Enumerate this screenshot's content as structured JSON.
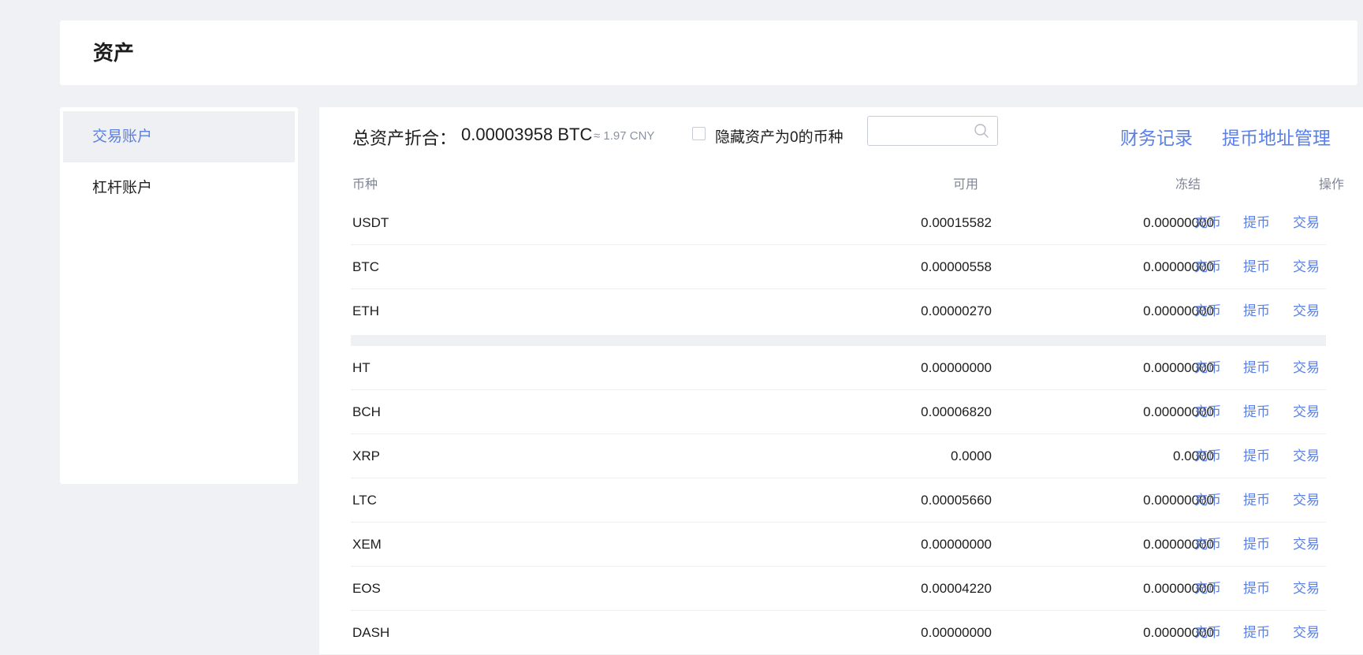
{
  "header": {
    "title": "资产"
  },
  "sidebar": {
    "items": [
      {
        "label": "交易账户"
      },
      {
        "label": "杠杆账户"
      }
    ]
  },
  "summary": {
    "label": "总资产折合：",
    "btc_value": "0.00003958 BTC",
    "cny_value": "≈ 1.97 CNY",
    "hide_zero_label": "隐藏资产为0的币种",
    "search_placeholder": ""
  },
  "links": {
    "records": "财务记录",
    "address": "提币地址管理"
  },
  "table": {
    "headers": {
      "coin": "币种",
      "available": "可用",
      "frozen": "冻结",
      "operation": "操作"
    },
    "actions": {
      "deposit": "充币",
      "withdraw": "提币",
      "trade": "交易"
    },
    "rows": [
      {
        "coin": "USDT",
        "available": "0.00015582",
        "frozen": "0.00000000"
      },
      {
        "coin": "BTC",
        "available": "0.00000558",
        "frozen": "0.00000000"
      },
      {
        "coin": "ETH",
        "available": "0.00000270",
        "frozen": "0.00000000"
      },
      {
        "coin": "HT",
        "available": "0.00000000",
        "frozen": "0.00000000"
      },
      {
        "coin": "BCH",
        "available": "0.00006820",
        "frozen": "0.00000000"
      },
      {
        "coin": "XRP",
        "available": "0.0000",
        "frozen": "0.0000"
      },
      {
        "coin": "LTC",
        "available": "0.00005660",
        "frozen": "0.00000000"
      },
      {
        "coin": "XEM",
        "available": "0.00000000",
        "frozen": "0.00000000"
      },
      {
        "coin": "EOS",
        "available": "0.00004220",
        "frozen": "0.00000000"
      },
      {
        "coin": "DASH",
        "available": "0.00000000",
        "frozen": "0.00000000"
      }
    ]
  },
  "colors": {
    "accent": "#5a7fe6",
    "background": "#eff1f5",
    "active_item_bg": "#eef0f4"
  }
}
